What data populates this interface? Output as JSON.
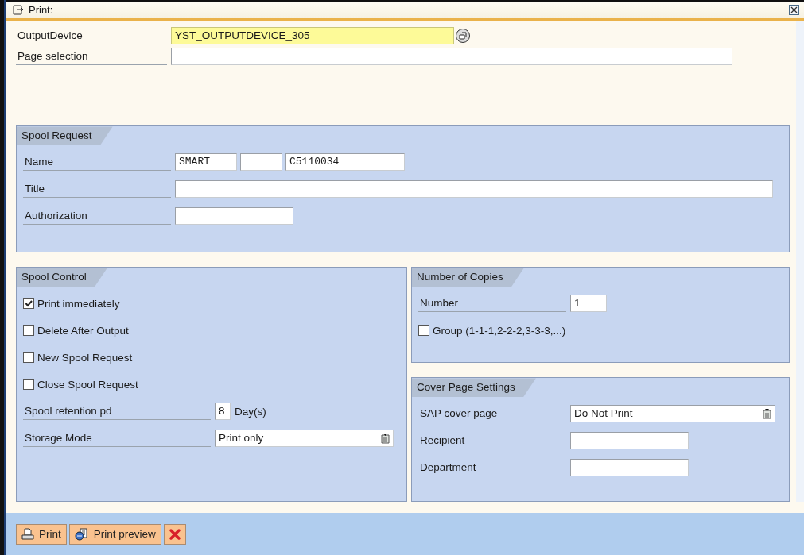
{
  "window": {
    "title": "Print:"
  },
  "top_fields": [
    {
      "label": "OutputDevice",
      "value": "YST_OUTPUTDEVICE_305",
      "focused": true,
      "kind": "device"
    },
    {
      "label": "Page selection",
      "focused": false,
      "kind": "text"
    }
  ],
  "spool_request": {
    "title": "Spool Request",
    "rows": [
      {
        "kind": "name",
        "label": "Name",
        "parts": [
          "SMART",
          "C5110034"
        ]
      },
      {
        "kind": "text",
        "label": "Title"
      },
      {
        "kind": "text",
        "label": "Authorization"
      }
    ]
  },
  "spool_control": {
    "title": "Spool Control",
    "rows": [
      {
        "kind": "checkbox",
        "label": "Print immediately",
        "checked": true
      },
      {
        "kind": "checkbox",
        "label": "Delete After Output",
        "checked": false
      },
      {
        "kind": "checkbox",
        "label": "New Spool Request",
        "checked": false
      },
      {
        "kind": "checkbox",
        "label": "Close Spool Request",
        "checked": false
      },
      {
        "kind": "retention",
        "label": "Spool retention pd",
        "value": "8",
        "unit": "Day(s)"
      },
      {
        "kind": "dropdown",
        "label": "Storage Mode",
        "value": "Print only"
      }
    ]
  },
  "number_of_copies": {
    "title": "Number of Copies",
    "rows": [
      {
        "kind": "text",
        "label": "Number",
        "value": "1"
      },
      {
        "kind": "checkbox",
        "label": "Group (1-1-1,2-2-2,3-3-3,...)",
        "checked": false
      }
    ]
  },
  "cover_page_settings": {
    "title": "Cover Page Settings",
    "rows": [
      {
        "kind": "dropdown",
        "label": "SAP cover page",
        "value": "Do Not Print"
      },
      {
        "kind": "text",
        "label": "Recipient"
      },
      {
        "kind": "text",
        "label": "Department"
      }
    ]
  },
  "buttons": [
    {
      "kind": "print",
      "label": "Print"
    },
    {
      "kind": "preview",
      "label": "Print preview"
    },
    {
      "kind": "cancel"
    }
  ]
}
